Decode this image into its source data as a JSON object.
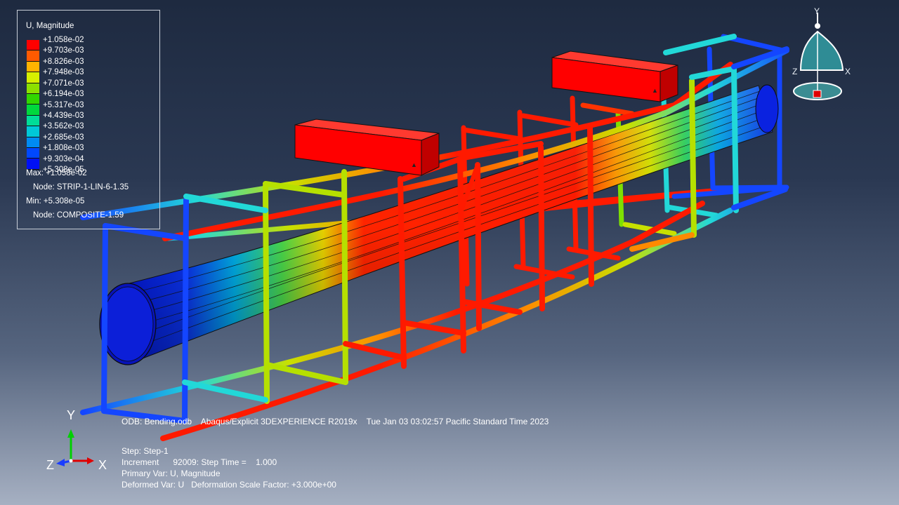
{
  "legend": {
    "title": "U, Magnitude",
    "levels": [
      "+1.058e-02",
      "+9.703e-03",
      "+8.826e-03",
      "+7.948e-03",
      "+7.071e-03",
      "+6.194e-03",
      "+5.317e-03",
      "+4.439e-03",
      "+3.562e-03",
      "+2.685e-03",
      "+1.808e-03",
      "+9.303e-04",
      "+5.308e-05"
    ],
    "colors": [
      "#ff0000",
      "#ff5a00",
      "#ffb300",
      "#d7ef00",
      "#8ce000",
      "#31d600",
      "#00d83d",
      "#00dd98",
      "#00c8d8",
      "#008bf2",
      "#0048ff",
      "#0010f5"
    ],
    "max_line": "Max: +1.058e-02",
    "max_node": "Node: STRIP-1-LIN-6-1.35",
    "min_line": "Min: +5.308e-05",
    "min_node": "Node: COMPOSITE-1.59"
  },
  "status": {
    "odb_line": "ODB: Bending.odb    Abaqus/Explicit 3DEXPERIENCE R2019x    Tue Jan 03 03:02:57 Pacific Standard Time 2023",
    "step": "Step: Step-1",
    "increment": "Increment      92009: Step Time =    1.000",
    "primary_var": "Primary Var: U, Magnitude",
    "deformed_var": "Deformed Var: U   Deformation Scale Factor: +3.000e+00"
  },
  "triad": {
    "y": "Y",
    "z": "Z",
    "x": "X"
  },
  "orient": {
    "y": "Y",
    "z": "Z",
    "x": "X"
  },
  "icons": {
    "triad": "xyz-axis-triad-icon",
    "orientation": "3d-view-orientation-icon"
  }
}
